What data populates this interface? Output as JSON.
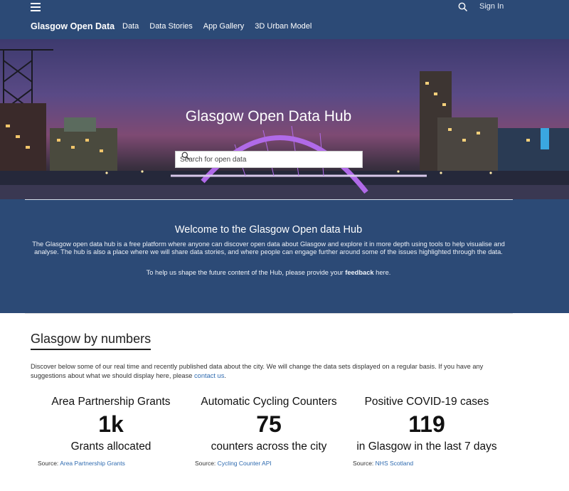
{
  "header": {
    "sign_in": "Sign In",
    "brand": "Glasgow Open Data",
    "nav": [
      "Data",
      "Data Stories",
      "App Gallery",
      "3D Urban Model"
    ]
  },
  "hero": {
    "title": "Glasgow Open Data Hub",
    "search_placeholder": "Search for open data"
  },
  "welcome": {
    "title": "Welcome to the Glasgow Open data Hub",
    "paragraph": "The Glasgow open data hub is a free platform where anyone can discover open data about Glasgow and explore it in more depth using tools to help visualise and analyse. The hub is also a place where we will share data stories, and where people can engage further around some of the issues highlighted through the data.",
    "help_prefix": "To help us shape the future content of the Hub, please provide your",
    "help_link": "feedback",
    "help_suffix": "here."
  },
  "numbers": {
    "title": "Glasgow by numbers",
    "intro": "Discover below some of our real time and recently published data about the city. We will change the data sets displayed on a regular basis. If you have any suggestions about what we should display here, please",
    "contact_link": "contact us",
    "cards": [
      {
        "label": "Area Partnership Grants",
        "value": "1k",
        "sub": "Grants allocated",
        "source_prefix": "Source:",
        "source_link": "Area Partnership Grants"
      },
      {
        "label": "Automatic Cycling Counters",
        "value": "75",
        "sub": "counters across the city",
        "source_prefix": "Source:",
        "source_link": "Cycling Counter API"
      },
      {
        "label": "Positive COVID-19 cases",
        "value": "119",
        "sub": "in Glasgow in the last 7 days",
        "source_prefix": "Source:",
        "source_link": "NHS Scotland"
      }
    ]
  },
  "colors": {
    "header_bg": "#2c4a76",
    "link": "#2f6bb0",
    "arch": "#b06ae8"
  },
  "icons": {
    "menu": "hamburger-icon",
    "search": "search-icon"
  }
}
